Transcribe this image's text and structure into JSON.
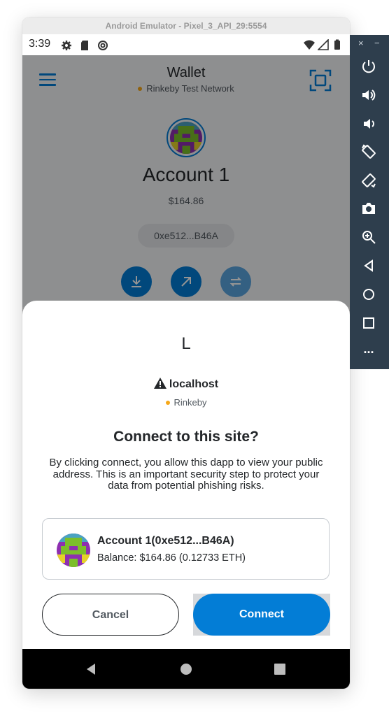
{
  "emulator": {
    "title": "Android Emulator - Pixel_3_API_29:5554",
    "side_controls": {
      "close": "×",
      "minimize": "−",
      "buttons": [
        "power-icon",
        "volume-up-icon",
        "volume-down-icon",
        "rotate-left-icon",
        "rotate-right-icon",
        "camera-icon",
        "zoom-icon",
        "back-icon",
        "home-icon",
        "overview-icon",
        "more-icon"
      ],
      "more_label": "..."
    }
  },
  "status_bar": {
    "time": "3:39",
    "icons_left": [
      "settings-icon",
      "sd-card-icon",
      "sync-icon"
    ],
    "icons_right": [
      "wifi-icon",
      "signal-icon",
      "battery-icon"
    ]
  },
  "wallet": {
    "title": "Wallet",
    "network": "Rinkeby Test Network",
    "account_name": "Account 1",
    "balance": "$164.86",
    "address": "0xe512...B46A",
    "actions": [
      "receive-icon",
      "send-icon",
      "swap-icon"
    ]
  },
  "connect_sheet": {
    "site_letter": "L",
    "site_host": "localhost",
    "network": "Rinkeby",
    "title": "Connect to this site?",
    "description": "By clicking connect, you allow this dapp to view your public address. This is an important security step to protect your data from potential phishing risks.",
    "account_label": "Account 1(0xe512...B46A)",
    "account_balance": "Balance: $164.86 (0.12733 ETH)",
    "cancel_label": "Cancel",
    "connect_label": "Connect"
  },
  "colors": {
    "accent": "#037dd6",
    "network_dot": "#f6a819",
    "text_primary": "#24272a"
  }
}
